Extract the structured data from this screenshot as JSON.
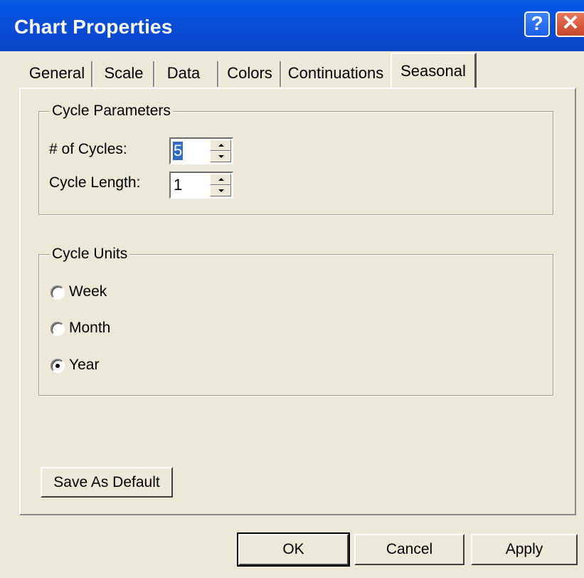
{
  "window": {
    "title": "Chart Properties",
    "help_glyph": "?",
    "close_glyph": "✕"
  },
  "tabs": [
    {
      "label": "General"
    },
    {
      "label": "Scale"
    },
    {
      "label": "Data"
    },
    {
      "label": "Colors"
    },
    {
      "label": "Continuations"
    },
    {
      "label": "Seasonal",
      "active": true
    }
  ],
  "cycle_parameters": {
    "group_label": "Cycle Parameters",
    "num_cycles": {
      "label": "# of Cycles:",
      "value": "5"
    },
    "cycle_length": {
      "label": "Cycle Length:",
      "value": "1"
    }
  },
  "cycle_units": {
    "group_label": "Cycle Units",
    "options": [
      {
        "label": "Week",
        "checked": false
      },
      {
        "label": "Month",
        "checked": false
      },
      {
        "label": "Year",
        "checked": true
      }
    ]
  },
  "buttons": {
    "save_default": "Save As Default",
    "ok": "OK",
    "cancel": "Cancel",
    "apply": "Apply"
  },
  "colors": {
    "titlebar": "#0a4fd8",
    "dialog_bg": "#ece9d8",
    "close_button": "#c9432a",
    "selection": "#316ac5"
  }
}
